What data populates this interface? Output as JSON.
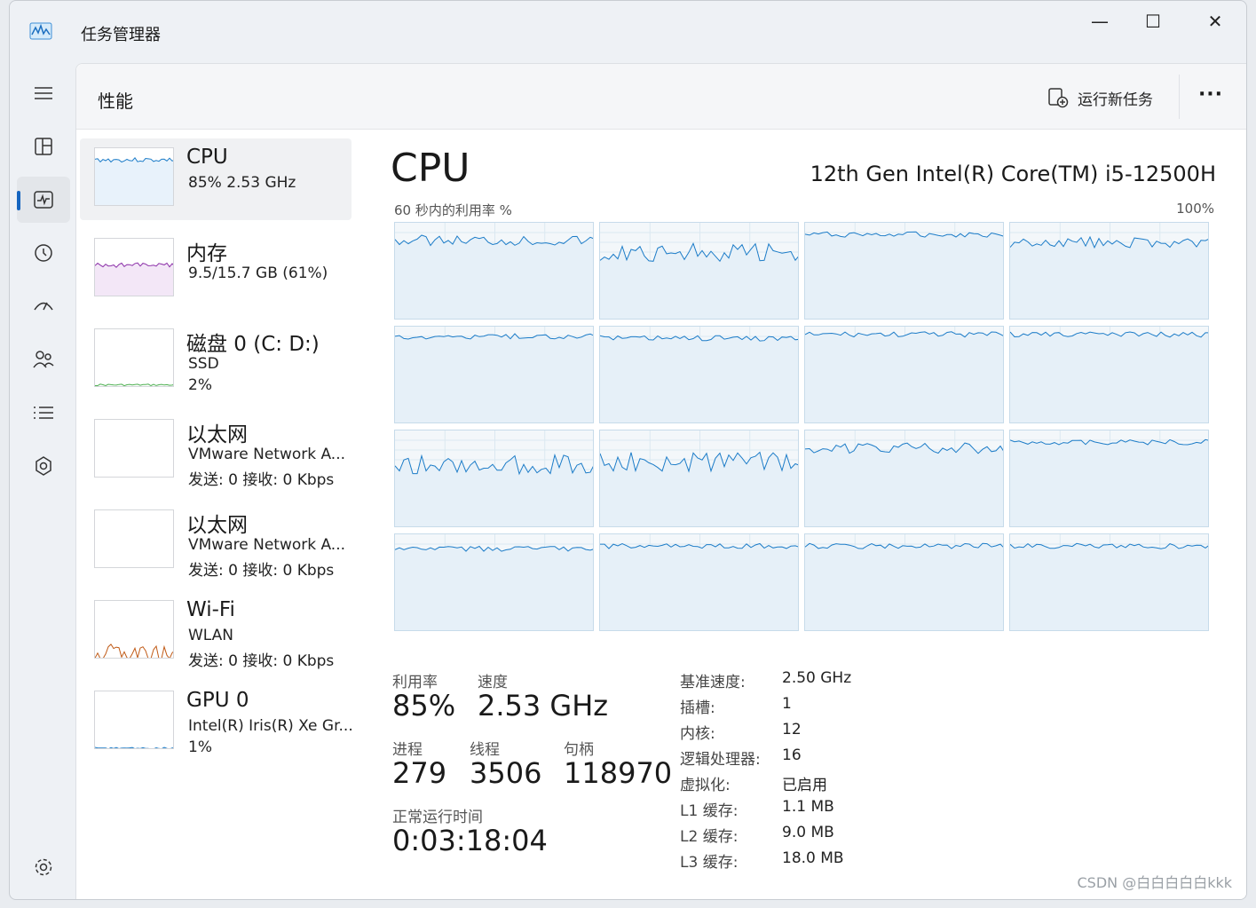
{
  "window": {
    "title": "任务管理器",
    "minimize": "—",
    "maximize": "☐",
    "close": "✕"
  },
  "header": {
    "page_title": "性能",
    "run_new_task": "运行新任务",
    "more": "···"
  },
  "nav": [
    {
      "icon": "hamburger-menu-icon"
    },
    {
      "icon": "processes-icon"
    },
    {
      "icon": "performance-icon",
      "active": true
    },
    {
      "icon": "app-history-icon"
    },
    {
      "icon": "startup-apps-icon"
    },
    {
      "icon": "users-icon"
    },
    {
      "icon": "details-icon"
    },
    {
      "icon": "services-icon"
    },
    {
      "icon": "settings-icon"
    }
  ],
  "devices": [
    {
      "name": "CPU",
      "line1": "85%  2.53 GHz",
      "line2": "",
      "color": "#1c7cc8"
    },
    {
      "name": "内存",
      "line1": "9.5/15.7 GB (61%)",
      "line2": "",
      "color": "#8b2fa8"
    },
    {
      "name": "磁盘 0 (C: D:)",
      "line1": "SSD",
      "line2": "2%",
      "color": "#4caf50"
    },
    {
      "name": "以太网",
      "line1": "VMware Network A...",
      "line2": "发送: 0  接收: 0 Kbps",
      "color": "#b0701c"
    },
    {
      "name": "以太网",
      "line1": "VMware Network A...",
      "line2": "发送: 0  接收: 0 Kbps",
      "color": "#b0701c"
    },
    {
      "name": "Wi-Fi",
      "line1": "WLAN",
      "line2": "发送: 0  接收: 0 Kbps",
      "color": "#c05a16"
    },
    {
      "name": "GPU 0",
      "line1": "Intel(R) Iris(R) Xe Gr...",
      "line2": "1%",
      "color": "#1c7cc8"
    }
  ],
  "cpu_panel": {
    "title": "CPU",
    "model": "12th Gen Intel(R) Core(TM) i5-12500H",
    "util_label": "60 秒内的利用率 %",
    "util_max": "100%",
    "core_levels": [
      82,
      70,
      88,
      80,
      90,
      88,
      92,
      92,
      65,
      68,
      82,
      88,
      85,
      88,
      88,
      88
    ],
    "line_color": "#1c7cc8"
  },
  "stats": {
    "util_label": "利用率",
    "util_value": "85%",
    "speed_label": "速度",
    "speed_value": "2.53 GHz",
    "proc_label": "进程",
    "proc_value": "279",
    "thread_label": "线程",
    "thread_value": "3506",
    "handle_label": "句柄",
    "handle_value": "118970",
    "uptime_label": "正常运行时间",
    "uptime_value": "0:03:18:04"
  },
  "specs": [
    {
      "k": "基准速度:",
      "v": "2.50 GHz"
    },
    {
      "k": "插槽:",
      "v": "1"
    },
    {
      "k": "内核:",
      "v": "12"
    },
    {
      "k": "逻辑处理器:",
      "v": "16"
    },
    {
      "k": "虚拟化:",
      "v": "已启用"
    },
    {
      "k": "L1 缓存:",
      "v": "1.1 MB"
    },
    {
      "k": "L2 缓存:",
      "v": "9.0 MB"
    },
    {
      "k": "L3 缓存:",
      "v": "18.0 MB"
    }
  ],
  "watermark": "CSDN @白白白白白kkk"
}
